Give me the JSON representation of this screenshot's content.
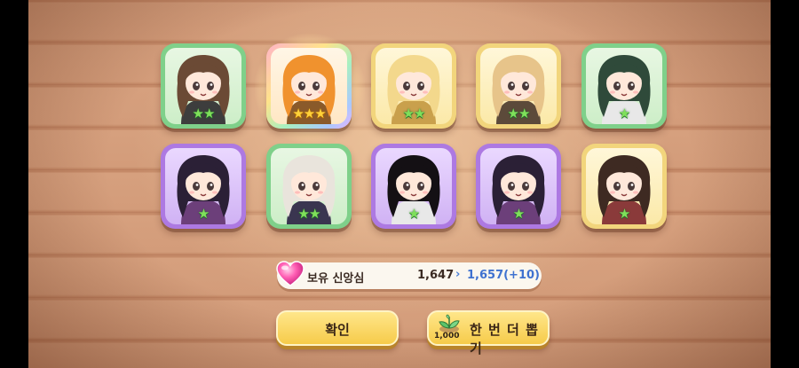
{
  "cards": [
    {
      "frame": "green",
      "stars": 2,
      "star_color": "green",
      "hair": "#6b4a35",
      "accent": "#3d3d3d"
    },
    {
      "frame": "rainbow",
      "stars": 3,
      "star_color": "gold",
      "hair": "#f0922e",
      "accent": "#8a5a2a"
    },
    {
      "frame": "yellow",
      "stars": 2,
      "star_color": "green",
      "hair": "#f3d88c",
      "accent": "#c9a04c"
    },
    {
      "frame": "yellow",
      "stars": 2,
      "star_color": "green",
      "hair": "#e7c48a",
      "accent": "#5c4a3a"
    },
    {
      "frame": "green",
      "stars": 1,
      "star_color": "green",
      "hair": "#2f4a3a",
      "accent": "#e8e8e8"
    },
    {
      "frame": "purple",
      "stars": 1,
      "star_color": "green",
      "hair": "#2b2036",
      "accent": "#6c3f7a"
    },
    {
      "frame": "green",
      "stars": 2,
      "star_color": "green",
      "hair": "#e9e4dc",
      "accent": "#3a3550"
    },
    {
      "frame": "purple",
      "stars": 1,
      "star_color": "green",
      "hair": "#141014",
      "accent": "#e8e8e8"
    },
    {
      "frame": "purple",
      "stars": 1,
      "star_color": "green",
      "hair": "#2b2036",
      "accent": "#6c3f7a"
    },
    {
      "frame": "yellow",
      "stars": 1,
      "star_color": "green",
      "hair": "#3e2a22",
      "accent": "#8a3a3a"
    }
  ],
  "currency": {
    "label": "보유 신앙심",
    "current": "1,647",
    "arrow": "›",
    "after": "1,657(+10)"
  },
  "buttons": {
    "confirm_label": "확인",
    "again_label": "한 번 더 뽑기",
    "again_cost": "1,000"
  },
  "colors": {
    "star_green": "#7fe05a",
    "star_gold": "#ffd23a",
    "button_yellow": "#f6cb4a",
    "currency_blue": "#3f72d0"
  }
}
